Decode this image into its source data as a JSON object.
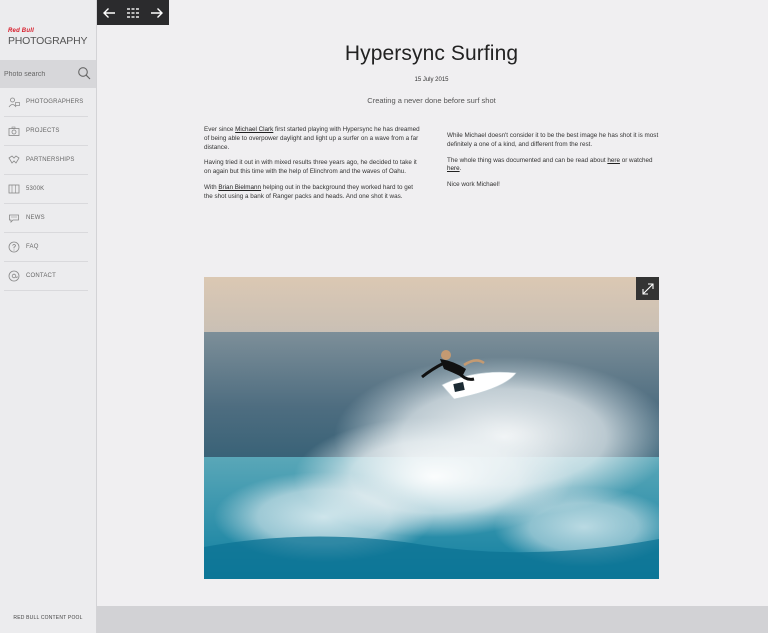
{
  "sidebar": {
    "logo": {
      "brand": "Red Bull",
      "wordmark": "PHOTOGRAPHY"
    },
    "search": {
      "placeholder": "Photo search"
    },
    "items": [
      {
        "label": "PHOTOGRAPHERS",
        "icon": "photographers-icon"
      },
      {
        "label": "PROJECTS",
        "icon": "camera-icon"
      },
      {
        "label": "PARTNERSHIPS",
        "icon": "partnerships-icon"
      },
      {
        "label": "5300K",
        "icon": "5300k-icon"
      },
      {
        "label": "NEWS",
        "icon": "news-icon"
      },
      {
        "label": "FAQ",
        "icon": "question-icon"
      },
      {
        "label": "CONTACT",
        "icon": "at-icon"
      }
    ],
    "footer": "RED BULL CONTENT POOL"
  },
  "toolbar": {
    "prev_icon": "arrow-left-icon",
    "grid_icon": "grid-icon",
    "next_icon": "arrow-right-icon"
  },
  "article": {
    "title": "Hypersync Surfing",
    "date": "15 July 2015",
    "subtitle": "Creating a never done before surf shot",
    "left": {
      "p1_before": "Ever since ",
      "p1_link": "Michael Clark",
      "p1_after": " first started playing with Hypersync he has dreamed of being able to overpower daylight and light up a surfer on a wave from a far distance.",
      "p2": "Having tried it out in with mixed results three years ago, he decided to take it on again but this time with the help of Elinchrom and the waves of Oahu.",
      "p3_before": "With ",
      "p3_link": "Brian Bielmann",
      "p3_after": " helping out in the background they worked hard to get the shot using a bank of Ranger packs and heads. And one shot it was."
    },
    "right": {
      "p1": "While Michael doesn't consider it to be the best image he has shot it is most definitely a one of a kind, and different from the rest.",
      "p2_before": "The whole thing was documented and can be read about ",
      "p2_link1": "here",
      "p2_mid": " or watched ",
      "p2_link2": "here",
      "p2_after": ".",
      "p3": "Nice work Michael!"
    },
    "photo_expand_icon": "expand-icon"
  },
  "colors": {
    "brand_red": "#d71a28",
    "toolbar_bg": "#2b2b2d",
    "sidebar_bg": "#ececee",
    "page_bg": "#f0eff1"
  }
}
